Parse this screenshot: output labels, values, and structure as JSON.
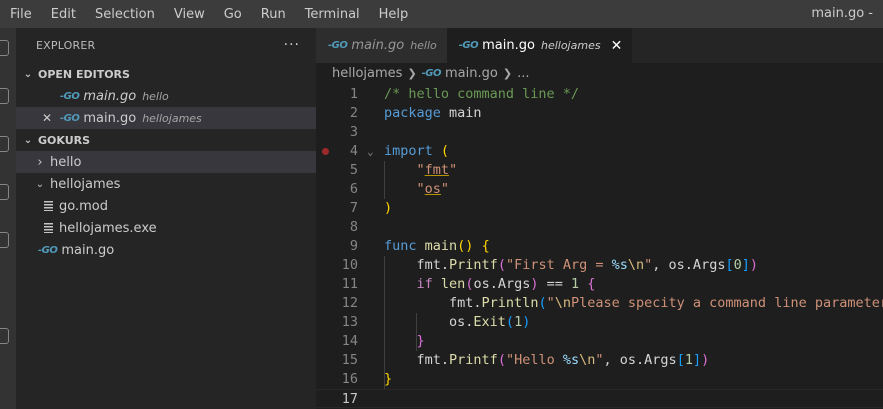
{
  "menu": [
    "File",
    "Edit",
    "Selection",
    "View",
    "Go",
    "Run",
    "Terminal",
    "Help"
  ],
  "window_title": "main.go - ",
  "explorer": {
    "title": "EXPLORER",
    "more": "···",
    "open_editors": {
      "label": "OPEN EDITORS",
      "items": [
        {
          "name": "main.go",
          "desc": "hello"
        },
        {
          "name": "main.go",
          "desc": "hellojames"
        }
      ]
    },
    "workspace": {
      "label": "GOKURS",
      "tree": [
        {
          "name": "hello",
          "type": "folder",
          "expanded": false
        },
        {
          "name": "hellojames",
          "type": "folder",
          "expanded": true
        },
        {
          "name": "go.mod",
          "type": "file"
        },
        {
          "name": "hellojames.exe",
          "type": "file"
        },
        {
          "name": "main.go",
          "type": "go"
        }
      ]
    }
  },
  "tabs": [
    {
      "name": "main.go",
      "desc": "hello",
      "active": false
    },
    {
      "name": "main.go",
      "desc": "hellojames",
      "active": true
    }
  ],
  "go_badge": "-GO",
  "breadcrumb": {
    "folder": "hellojames",
    "file": "main.go",
    "more": "..."
  },
  "code": {
    "line_numbers": [
      "1",
      "2",
      "3",
      "4",
      "5",
      "6",
      "7",
      "8",
      "9",
      "10",
      "11",
      "12",
      "13",
      "14",
      "15",
      "16",
      "17"
    ],
    "current_line": 17,
    "breakpoint_line": 4,
    "lines": [
      "/* hello command line */",
      "package main",
      "",
      "import (",
      "    \"fmt\"",
      "    \"os\"",
      ")",
      "",
      "func main() {",
      "    fmt.Printf(\"First Arg = %s\\n\", os.Args[0])",
      "    if len(os.Args) == 1 {",
      "        fmt.Println(\"\\nPlease specity a command line parameter\")",
      "        os.Exit(1)",
      "    }",
      "    fmt.Printf(\"Hello %s\\n\", os.Args[1])",
      "}",
      ""
    ]
  }
}
